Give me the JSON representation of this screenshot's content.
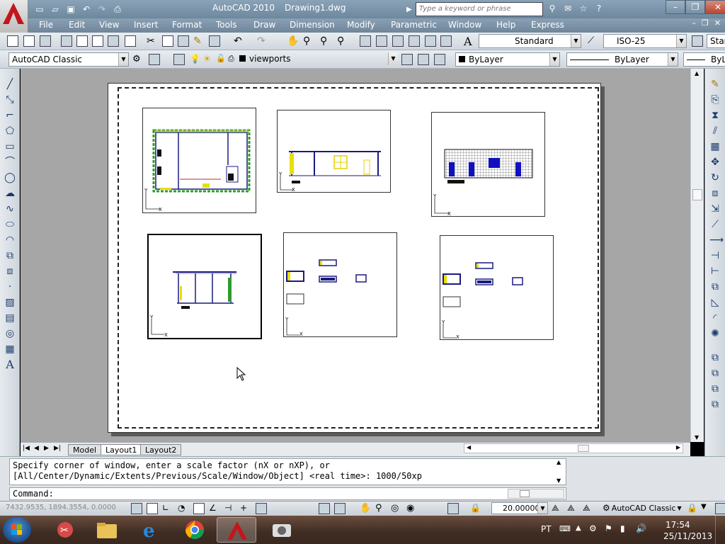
{
  "title": {
    "app": "AutoCAD 2010",
    "document": "Drawing1.dwg"
  },
  "search": {
    "placeholder": "Type a keyword or phrase"
  },
  "menus": [
    "File",
    "Edit",
    "View",
    "Insert",
    "Format",
    "Tools",
    "Draw",
    "Dimension",
    "Modify",
    "Parametric",
    "Window",
    "Help",
    "Express"
  ],
  "toolbar": {
    "text_style": "Standard",
    "dim_style": "ISO-25",
    "table_style": "Star",
    "workspace": "AutoCAD Classic",
    "layer": "viewports",
    "color": "ByLayer",
    "linetype": "ByLayer",
    "lineweight": "ByL"
  },
  "tabs": {
    "nav": [
      "|◀",
      "◀",
      "▶",
      "▶|"
    ],
    "items": [
      "Model",
      "Layout1",
      "Layout2"
    ],
    "active": "Layout1"
  },
  "command": {
    "line1": "Specify corner of window, enter a scale factor (nX or nXP), or",
    "line2": "[All/Center/Dynamic/Extents/Previous/Scale/Window/Object] <real time>: 1000/50xp",
    "prompt": "Command:"
  },
  "status": {
    "coords": "7432.9535, 1894.3554, 0.0000",
    "scale": "20.000000",
    "workspace": "AutoCAD Classic"
  },
  "viewports": {
    "ucs_x": "X",
    "ucs_y": "Y"
  },
  "tray": {
    "lang": "PT",
    "time": "17:54",
    "date": "25/11/2013"
  },
  "colors": {
    "accent": "#6f869a",
    "paper": "#ffffff",
    "background": "#a6a6a6"
  }
}
